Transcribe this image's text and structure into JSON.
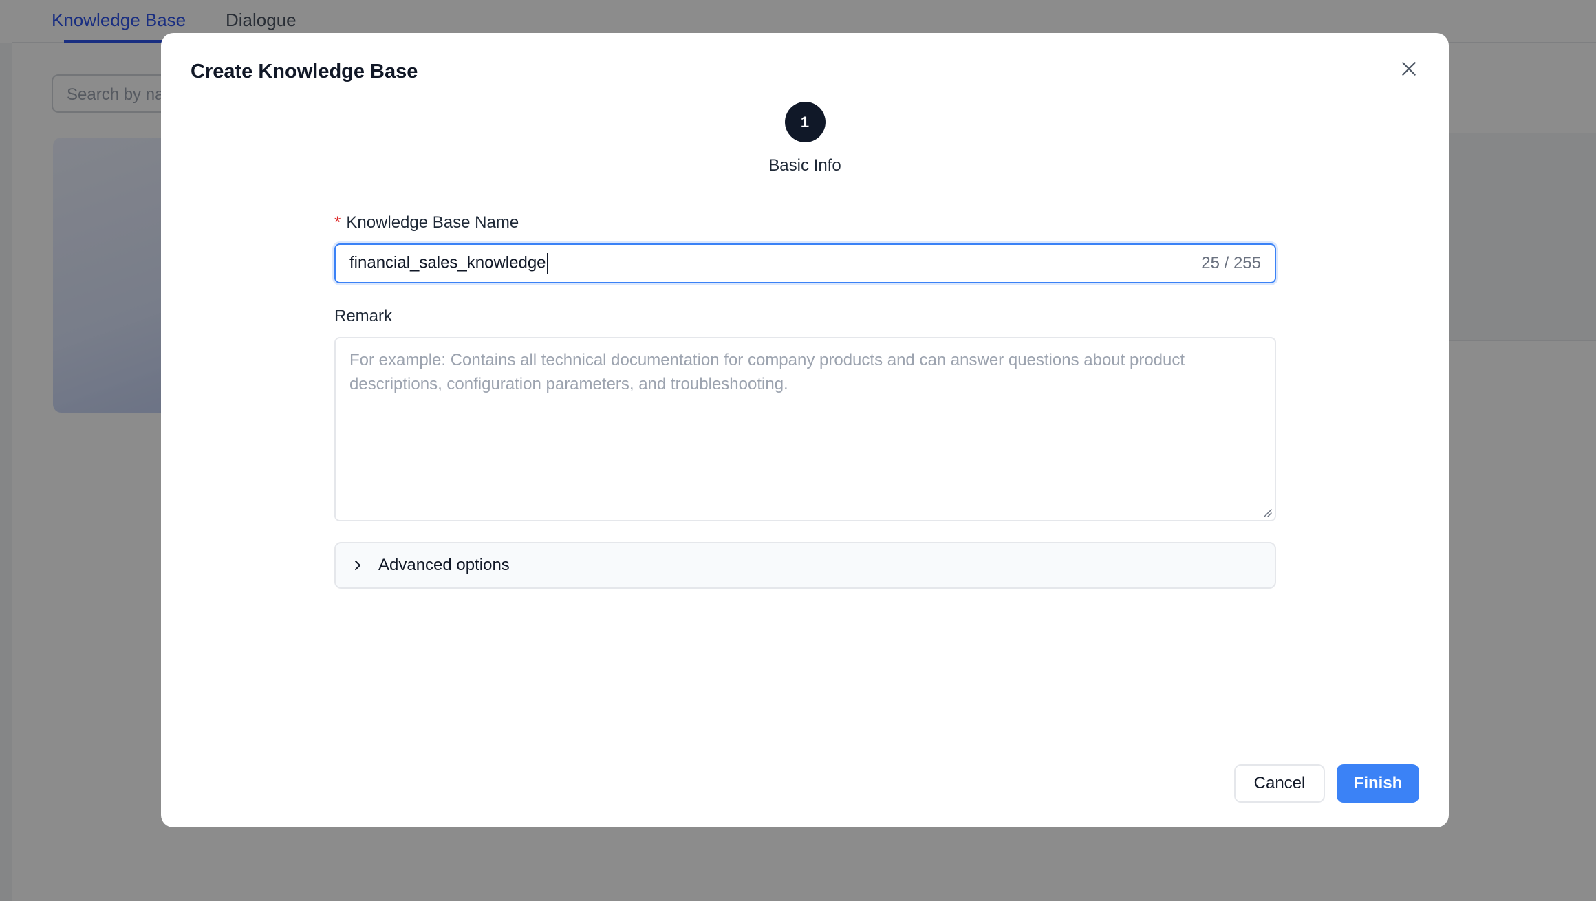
{
  "background": {
    "tabs": [
      {
        "label": "Knowledge Base"
      },
      {
        "label": "Dialogue"
      }
    ],
    "search": {
      "placeholder": "Search by na"
    }
  },
  "modal": {
    "title": "Create Knowledge Base",
    "close_icon": "close-icon",
    "step": {
      "number": "1",
      "label": "Basic Info"
    },
    "name_field": {
      "required_mark": "*",
      "label": "Knowledge Base Name",
      "value": "financial_sales_knowledge",
      "counter": "25 / 255"
    },
    "remark_field": {
      "label": "Remark",
      "placeholder": "For example: Contains all technical documentation for company products and can answer questions about product descriptions, configuration parameters, and troubleshooting."
    },
    "advanced": {
      "label": "Advanced options",
      "icon": "chevron-right-icon"
    },
    "buttons": {
      "cancel": "Cancel",
      "finish": "Finish"
    }
  },
  "colors": {
    "accent": "#3b82f6",
    "step_circle": "#101828",
    "required": "#dc2626",
    "tab_active": "#2f54eb"
  }
}
